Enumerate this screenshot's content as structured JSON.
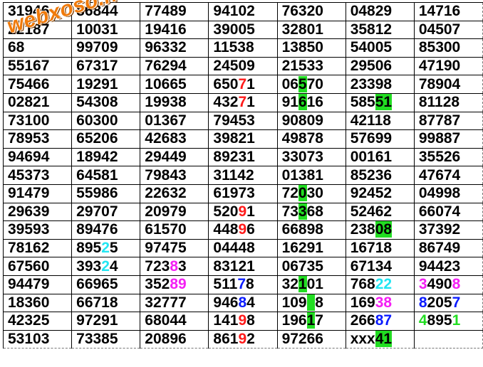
{
  "watermark": "webxoso.net",
  "colors": {
    "highlight": "#22dd22",
    "red": "#ff1a1a",
    "blue": "#0b1cff",
    "cyan": "#22e6f2",
    "magenta": "#f41ff4",
    "green": "#22dd22"
  },
  "rows": [
    [
      [
        [
          "31946"
        ]
      ],
      [
        [
          "86844"
        ]
      ],
      [
        [
          "77489"
        ]
      ],
      [
        [
          "94102"
        ]
      ],
      [
        [
          "76320"
        ]
      ],
      [
        [
          "04829"
        ]
      ],
      [
        [
          "14716"
        ]
      ]
    ],
    [
      [
        [
          "22187"
        ]
      ],
      [
        [
          "10031"
        ]
      ],
      [
        [
          "19416"
        ]
      ],
      [
        [
          "39005"
        ]
      ],
      [
        [
          "32801"
        ]
      ],
      [
        [
          "35812"
        ]
      ],
      [
        [
          "04507"
        ]
      ]
    ],
    [
      [
        [
          "68"
        ]
      ],
      [
        [
          "99709"
        ]
      ],
      [
        [
          "96332"
        ]
      ],
      [
        [
          "11538"
        ]
      ],
      [
        [
          "13850"
        ]
      ],
      [
        [
          "54005"
        ]
      ],
      [
        [
          "85300"
        ]
      ]
    ],
    [
      [
        [
          "55167"
        ]
      ],
      [
        [
          "67317"
        ]
      ],
      [
        [
          "76294"
        ]
      ],
      [
        [
          "24509"
        ]
      ],
      [
        [
          "21533"
        ]
      ],
      [
        [
          "29506"
        ]
      ],
      [
        [
          "47190"
        ]
      ]
    ],
    [
      [
        [
          "75466"
        ]
      ],
      [
        [
          "19291"
        ]
      ],
      [
        [
          "10665"
        ]
      ],
      [
        [
          "650"
        ],
        [
          "7",
          "red"
        ],
        [
          "1"
        ]
      ],
      [
        [
          "06"
        ],
        [
          "5",
          "",
          "hl"
        ],
        [
          "70"
        ]
      ],
      [
        [
          "23398"
        ]
      ],
      [
        [
          "78904"
        ]
      ]
    ],
    [
      [
        [
          "02821"
        ]
      ],
      [
        [
          "54308"
        ]
      ],
      [
        [
          "19938"
        ]
      ],
      [
        [
          "432"
        ],
        [
          "7",
          "red"
        ],
        [
          "1"
        ]
      ],
      [
        [
          "91"
        ],
        [
          "6",
          "",
          "hl"
        ],
        [
          "16"
        ]
      ],
      [
        [
          "585"
        ],
        [
          "51",
          "",
          "hl"
        ]
      ],
      [
        [
          "81128"
        ]
      ]
    ],
    [
      [
        [
          "73100"
        ]
      ],
      [
        [
          "60300"
        ]
      ],
      [
        [
          "01367"
        ]
      ],
      [
        [
          "79453"
        ]
      ],
      [
        [
          "90809"
        ]
      ],
      [
        [
          "42118"
        ]
      ],
      [
        [
          "87787"
        ]
      ]
    ],
    [
      [
        [
          "78953"
        ]
      ],
      [
        [
          "65206"
        ]
      ],
      [
        [
          "42683"
        ]
      ],
      [
        [
          "39821"
        ]
      ],
      [
        [
          "49878"
        ]
      ],
      [
        [
          "57699"
        ]
      ],
      [
        [
          "99887"
        ]
      ]
    ],
    [
      [
        [
          "94694"
        ]
      ],
      [
        [
          "18942"
        ]
      ],
      [
        [
          "29449"
        ]
      ],
      [
        [
          "89231"
        ]
      ],
      [
        [
          "33073"
        ]
      ],
      [
        [
          "00161"
        ]
      ],
      [
        [
          "35526"
        ]
      ]
    ],
    [
      [
        [
          "45373"
        ]
      ],
      [
        [
          "64581"
        ]
      ],
      [
        [
          "79843"
        ]
      ],
      [
        [
          "31142"
        ]
      ],
      [
        [
          "01381"
        ]
      ],
      [
        [
          "85236"
        ]
      ],
      [
        [
          "47674"
        ]
      ]
    ],
    [
      [
        [
          "91479"
        ]
      ],
      [
        [
          "55986"
        ]
      ],
      [
        [
          "22632"
        ]
      ],
      [
        [
          "61973"
        ]
      ],
      [
        [
          "72"
        ],
        [
          "0",
          "",
          "hl"
        ],
        [
          "30"
        ]
      ],
      [
        [
          "92452"
        ]
      ],
      [
        [
          "04998"
        ]
      ]
    ],
    [
      [
        [
          "29639"
        ]
      ],
      [
        [
          "29707"
        ]
      ],
      [
        [
          "20979"
        ]
      ],
      [
        [
          "520"
        ],
        [
          "9",
          "red"
        ],
        [
          "1"
        ]
      ],
      [
        [
          "73"
        ],
        [
          "3",
          "",
          "hl"
        ],
        [
          "68"
        ]
      ],
      [
        [
          "52462"
        ]
      ],
      [
        [
          "66074"
        ]
      ]
    ],
    [
      [
        [
          "39593"
        ]
      ],
      [
        [
          "89476"
        ]
      ],
      [
        [
          "61570"
        ]
      ],
      [
        [
          "448"
        ],
        [
          "9",
          "red"
        ],
        [
          "6"
        ]
      ],
      [
        [
          "66898"
        ]
      ],
      [
        [
          "238"
        ],
        [
          "08",
          "",
          "hl"
        ]
      ],
      [
        [
          "37392"
        ]
      ]
    ],
    [
      [
        [
          "78162"
        ]
      ],
      [
        [
          "895"
        ],
        [
          "2",
          "cyan"
        ],
        [
          "5"
        ]
      ],
      [
        [
          "97475"
        ]
      ],
      [
        [
          "04448"
        ]
      ],
      [
        [
          "16291"
        ]
      ],
      [
        [
          "16718"
        ]
      ],
      [
        [
          "86749"
        ]
      ]
    ],
    [
      [
        [
          "67560"
        ]
      ],
      [
        [
          "393"
        ],
        [
          "2",
          "cyan"
        ],
        [
          "4"
        ]
      ],
      [
        [
          "723"
        ],
        [
          "8",
          "magenta"
        ],
        [
          "3"
        ]
      ],
      [
        [
          "83121"
        ]
      ],
      [
        [
          "06735"
        ]
      ],
      [
        [
          "67134"
        ]
      ],
      [
        [
          "94423"
        ]
      ]
    ],
    [
      [
        [
          "94479"
        ]
      ],
      [
        [
          "66965"
        ]
      ],
      [
        [
          "352"
        ],
        [
          "89",
          "magenta"
        ]
      ],
      [
        [
          "511"
        ],
        [
          "7",
          "blue"
        ],
        [
          "8"
        ]
      ],
      [
        [
          "32"
        ],
        [
          "1",
          "",
          "hl"
        ],
        [
          "01"
        ]
      ],
      [
        [
          "768"
        ],
        [
          "22",
          "cyan"
        ]
      ],
      [
        [
          "3",
          "magenta"
        ],
        [
          "490"
        ],
        [
          "8",
          "magenta"
        ]
      ]
    ],
    [
      [
        [
          "18360"
        ]
      ],
      [
        [
          "66718"
        ]
      ],
      [
        [
          "32777"
        ]
      ],
      [
        [
          "946"
        ],
        [
          "8",
          "blue"
        ],
        [
          "4"
        ]
      ],
      [
        [
          "109"
        ],
        [
          "9",
          "green",
          "hl"
        ],
        [
          "8"
        ]
      ],
      [
        [
          "169"
        ],
        [
          "38",
          "magenta"
        ]
      ],
      [
        [
          "8",
          "blue"
        ],
        [
          "205"
        ],
        [
          "7",
          "blue"
        ]
      ]
    ],
    [
      [
        [
          "42325"
        ]
      ],
      [
        [
          "97291"
        ]
      ],
      [
        [
          "68044"
        ]
      ],
      [
        [
          "141"
        ],
        [
          "9",
          "red"
        ],
        [
          "8"
        ]
      ],
      [
        [
          "196"
        ],
        [
          "1",
          "",
          "hl"
        ],
        [
          "7"
        ]
      ],
      [
        [
          "266"
        ],
        [
          "87",
          "blue"
        ]
      ],
      [
        [
          "4",
          "green"
        ],
        [
          "895"
        ],
        [
          "1",
          "green"
        ]
      ]
    ],
    [
      [
        [
          "53103"
        ]
      ],
      [
        [
          "73385"
        ]
      ],
      [
        [
          "20896"
        ]
      ],
      [
        [
          "861"
        ],
        [
          "9",
          "red"
        ],
        [
          "2"
        ]
      ],
      [
        [
          "97266"
        ]
      ],
      [
        [
          "xxx"
        ],
        [
          "41",
          "",
          "hl"
        ]
      ],
      []
    ]
  ]
}
